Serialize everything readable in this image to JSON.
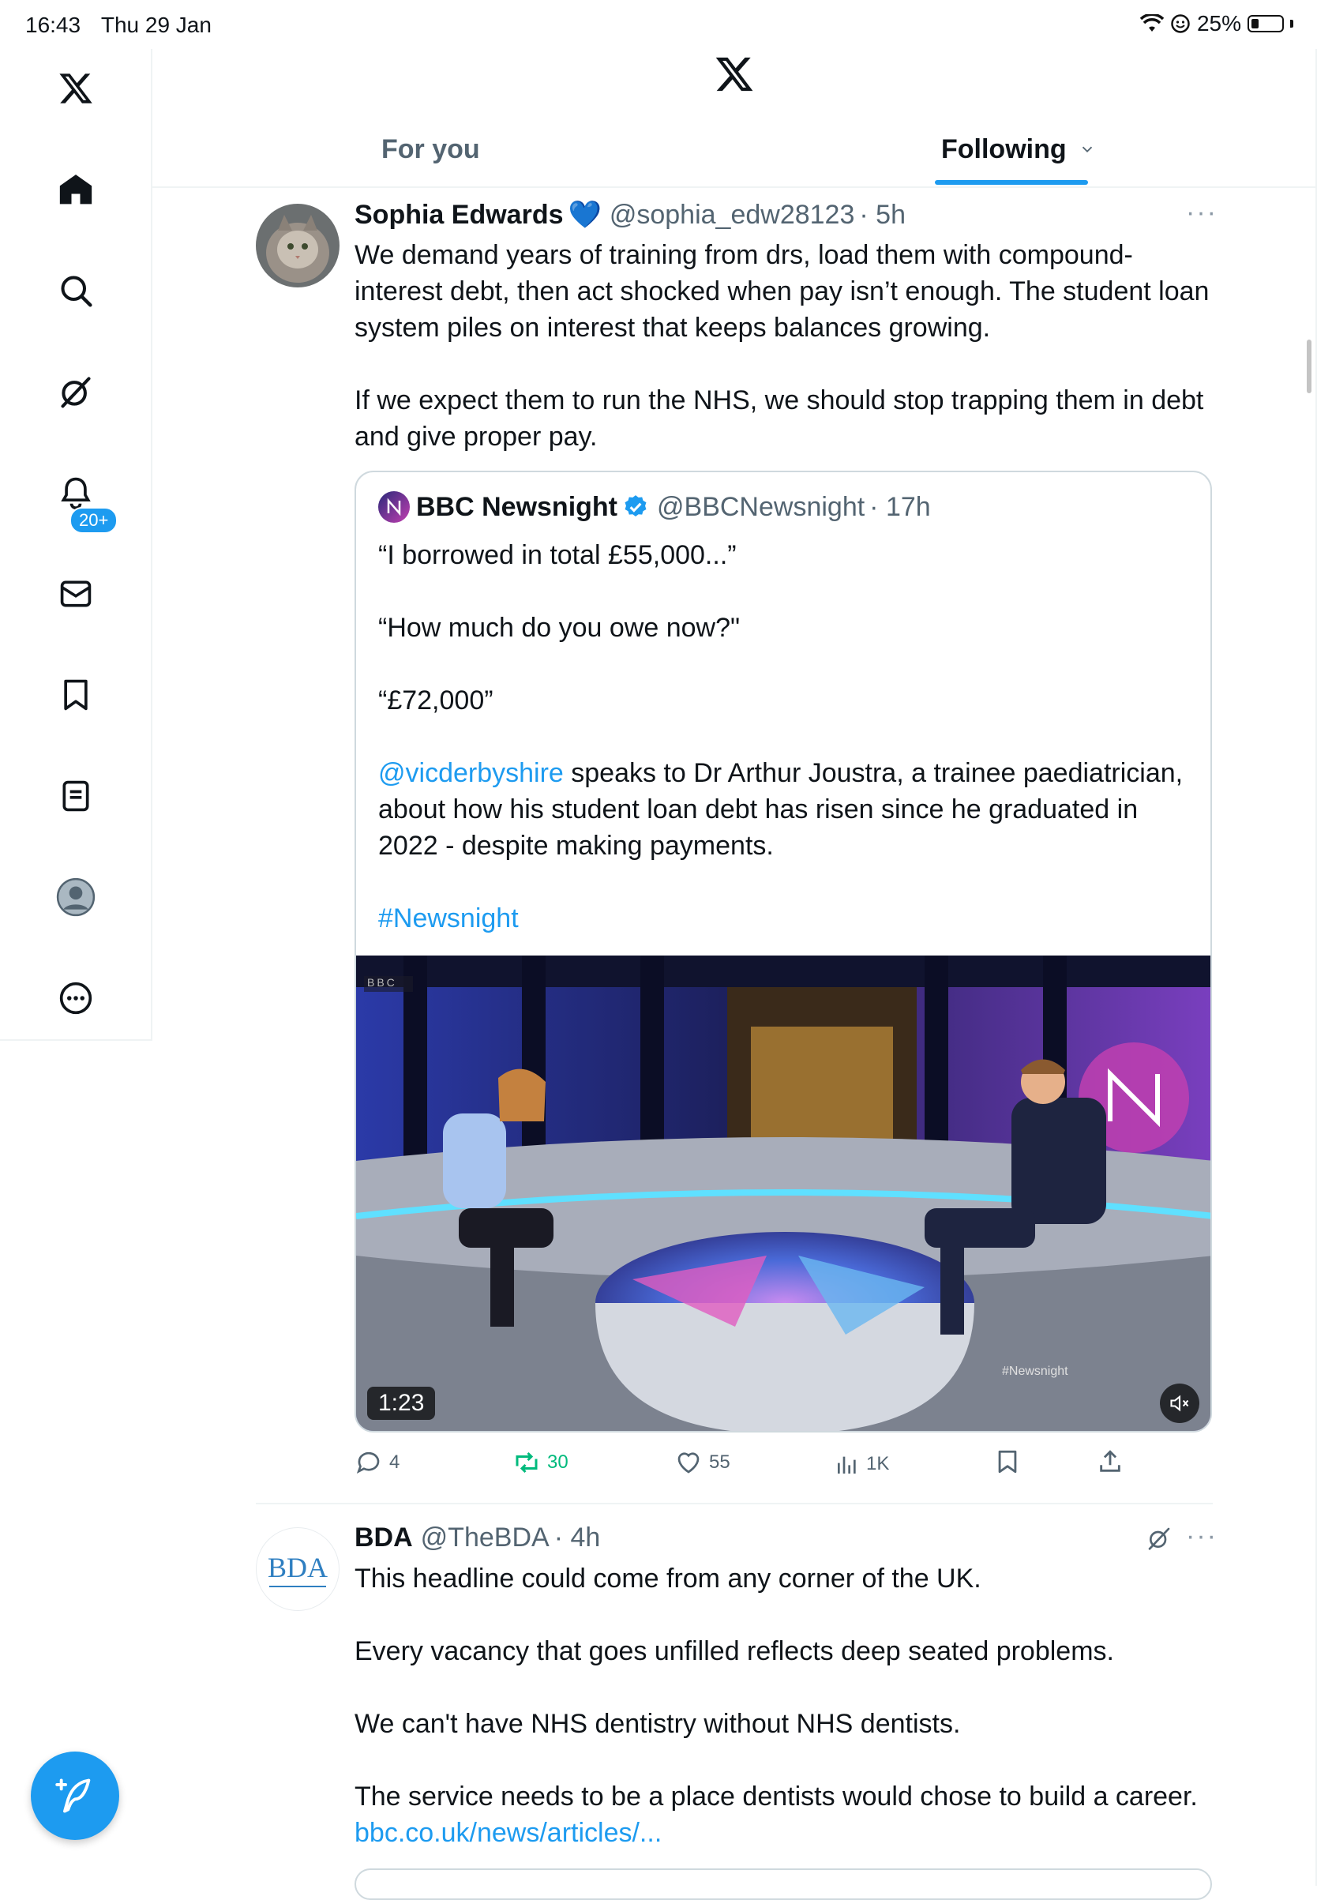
{
  "status_bar": {
    "time": "16:43",
    "date": "Thu 29 Jan",
    "battery_label": "25%",
    "battery_level": 0.25
  },
  "sidebar": {
    "items": [
      {
        "icon": "x-logo-icon"
      },
      {
        "icon": "home-icon"
      },
      {
        "icon": "search-icon"
      },
      {
        "icon": "grok-icon"
      },
      {
        "icon": "notifications-icon",
        "badge": "20+"
      },
      {
        "icon": "messages-icon"
      },
      {
        "icon": "bookmarks-icon"
      },
      {
        "icon": "lists-icon"
      },
      {
        "icon": "profile-icon"
      },
      {
        "icon": "more-icon"
      }
    ],
    "compose_icon": "compose-icon"
  },
  "header": {
    "tabs": [
      {
        "label": "For you"
      },
      {
        "label": "Following"
      }
    ]
  },
  "feed": {
    "post1": {
      "name": "Sophia Edwards",
      "badge": "💙",
      "handle": "@sophia_edw28123",
      "time": "· 5h",
      "paragraphs": [
        "We demand years of training from drs, load them with compound-interest debt, then act shocked when pay isn’t enough. The student loan system piles on interest that keeps balances growing.",
        "If we expect them to run the NHS, we should stop trapping them in debt and give proper pay."
      ],
      "quote": {
        "name": "BBC Newsnight",
        "handle": "@BBCNewsnight",
        "time": "· 17h",
        "line1": "“I borrowed in total £55,000...”",
        "line2": "“How much do you owe now?\"",
        "line3": "“£72,000”",
        "mention": "@vicderbyshire",
        "body": " speaks to Dr Arthur Joustra, a trainee paediatrician, about how his student loan debt has risen since he graduated in 2022 - despite making payments.",
        "hashtag": "#Newsnight",
        "video": {
          "duration": "1:23",
          "channel_logo": "BBC",
          "overlay_tag": "#Newsnight"
        }
      },
      "actions": {
        "replies": "4",
        "reposts": "30",
        "likes": "55",
        "views": "1K"
      }
    },
    "post2": {
      "name": "BDA",
      "handle": "@TheBDA",
      "time": "· 4h",
      "avatar_text": "BDA",
      "paragraphs": [
        "This headline could come from any corner of the UK.",
        "Every vacancy that goes unfilled reflects deep seated problems.",
        "We can't have NHS dentistry without NHS dentists.",
        "The service needs to be a place dentists would chose to build a career."
      ],
      "link": "bbc.co.uk/news/articles/..."
    }
  },
  "colors": {
    "accent": "#1d9bf0",
    "text": "#0f1419",
    "secondary": "#536471",
    "repost_green": "#00ba7c"
  }
}
